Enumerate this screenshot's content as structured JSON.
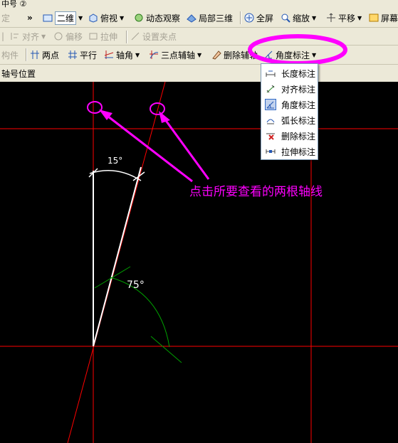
{
  "titlebar": {
    "text": "中号 ②"
  },
  "toolbar1": {
    "left_label": "定",
    "overflow": "»",
    "view2d": "二维",
    "topview": "俯视",
    "dynamic": "动态观察",
    "local3d": "局部三维",
    "fullscreen": "全屏",
    "zoom": "缩放",
    "pan": "平移",
    "screen": "屏幕"
  },
  "toolbar2": {
    "align": "对齐",
    "offset": "偏移",
    "stretch": "拉伸",
    "setpoint": "设置夹点"
  },
  "toolbar3": {
    "component": "构件",
    "twopoint": "两点",
    "parallel": "平行",
    "axisangle": "轴角",
    "threepoint": "三点辅轴",
    "delete_aux": "删除辅轴",
    "angle_dim": "角度标注"
  },
  "toolbar4": {
    "axis_pos": "轴号位置"
  },
  "dropdown": {
    "items": [
      {
        "label": "长度标注",
        "icon": "length-dim-icon"
      },
      {
        "label": "对齐标注",
        "icon": "align-dim-icon"
      },
      {
        "label": "角度标注",
        "icon": "angle-dim-icon"
      },
      {
        "label": "弧长标注",
        "icon": "arc-dim-icon"
      },
      {
        "label": "删除标注",
        "icon": "delete-dim-icon"
      },
      {
        "label": "拉伸标注",
        "icon": "stretch-dim-icon"
      }
    ],
    "selected_index": 2
  },
  "canvas": {
    "angle_a": "15°",
    "angle_b": "75°",
    "annotation": "点击所要查看的两根轴线"
  },
  "colors": {
    "background": "#000000",
    "grid_line": "#ff0000",
    "highlight": "#ff00ff",
    "dim_line": "#ffffff",
    "arc": "#00aa00"
  }
}
